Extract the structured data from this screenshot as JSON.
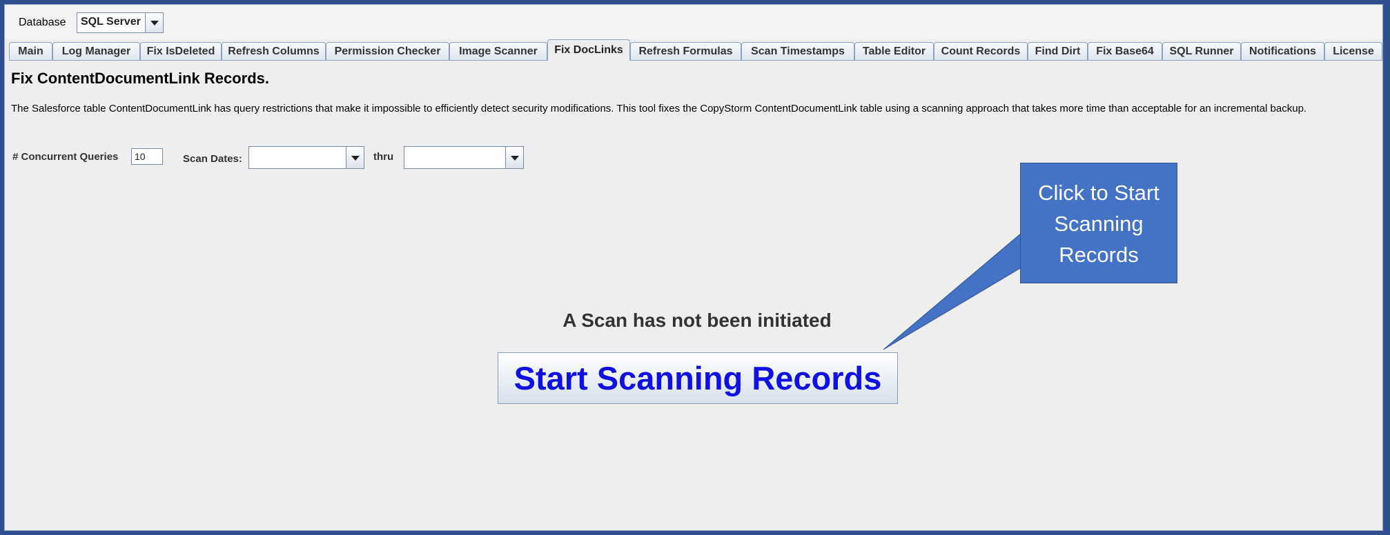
{
  "toolbar": {
    "database_label": "Database",
    "database_value": "SQL Server"
  },
  "tabs": [
    {
      "label": "Main"
    },
    {
      "label": "Log Manager"
    },
    {
      "label": "Fix IsDeleted"
    },
    {
      "label": "Refresh Columns"
    },
    {
      "label": "Permission Checker"
    },
    {
      "label": "Image Scanner"
    },
    {
      "label": "Fix DocLinks",
      "active": true
    },
    {
      "label": "Refresh Formulas"
    },
    {
      "label": "Scan Timestamps"
    },
    {
      "label": "Table Editor"
    },
    {
      "label": "Count Records"
    },
    {
      "label": "Find Dirt"
    },
    {
      "label": "Fix Base64"
    },
    {
      "label": "SQL Runner"
    },
    {
      "label": "Notifications"
    },
    {
      "label": "License"
    }
  ],
  "content": {
    "title": "Fix ContentDocumentLink Records.",
    "description": "The Salesforce table ContentDocumentLink has query restrictions that make it impossible to efficiently detect security modifications. This tool fixes the CopyStorm ContentDocumentLink table using a scanning approach that takes more time than acceptable for an incremental backup.",
    "concurrent_label": "# Concurrent Queries",
    "concurrent_value": "10",
    "scan_dates_label": "Scan Dates:",
    "scan_from_value": "",
    "thru_label": "thru",
    "scan_to_value": "",
    "status_text": "A Scan has not been initiated",
    "start_button_label": "Start Scanning Records"
  },
  "callout": {
    "line1": "Click to Start",
    "line2": "Scanning",
    "line3": "Records",
    "fill_color": "#4472c4"
  }
}
